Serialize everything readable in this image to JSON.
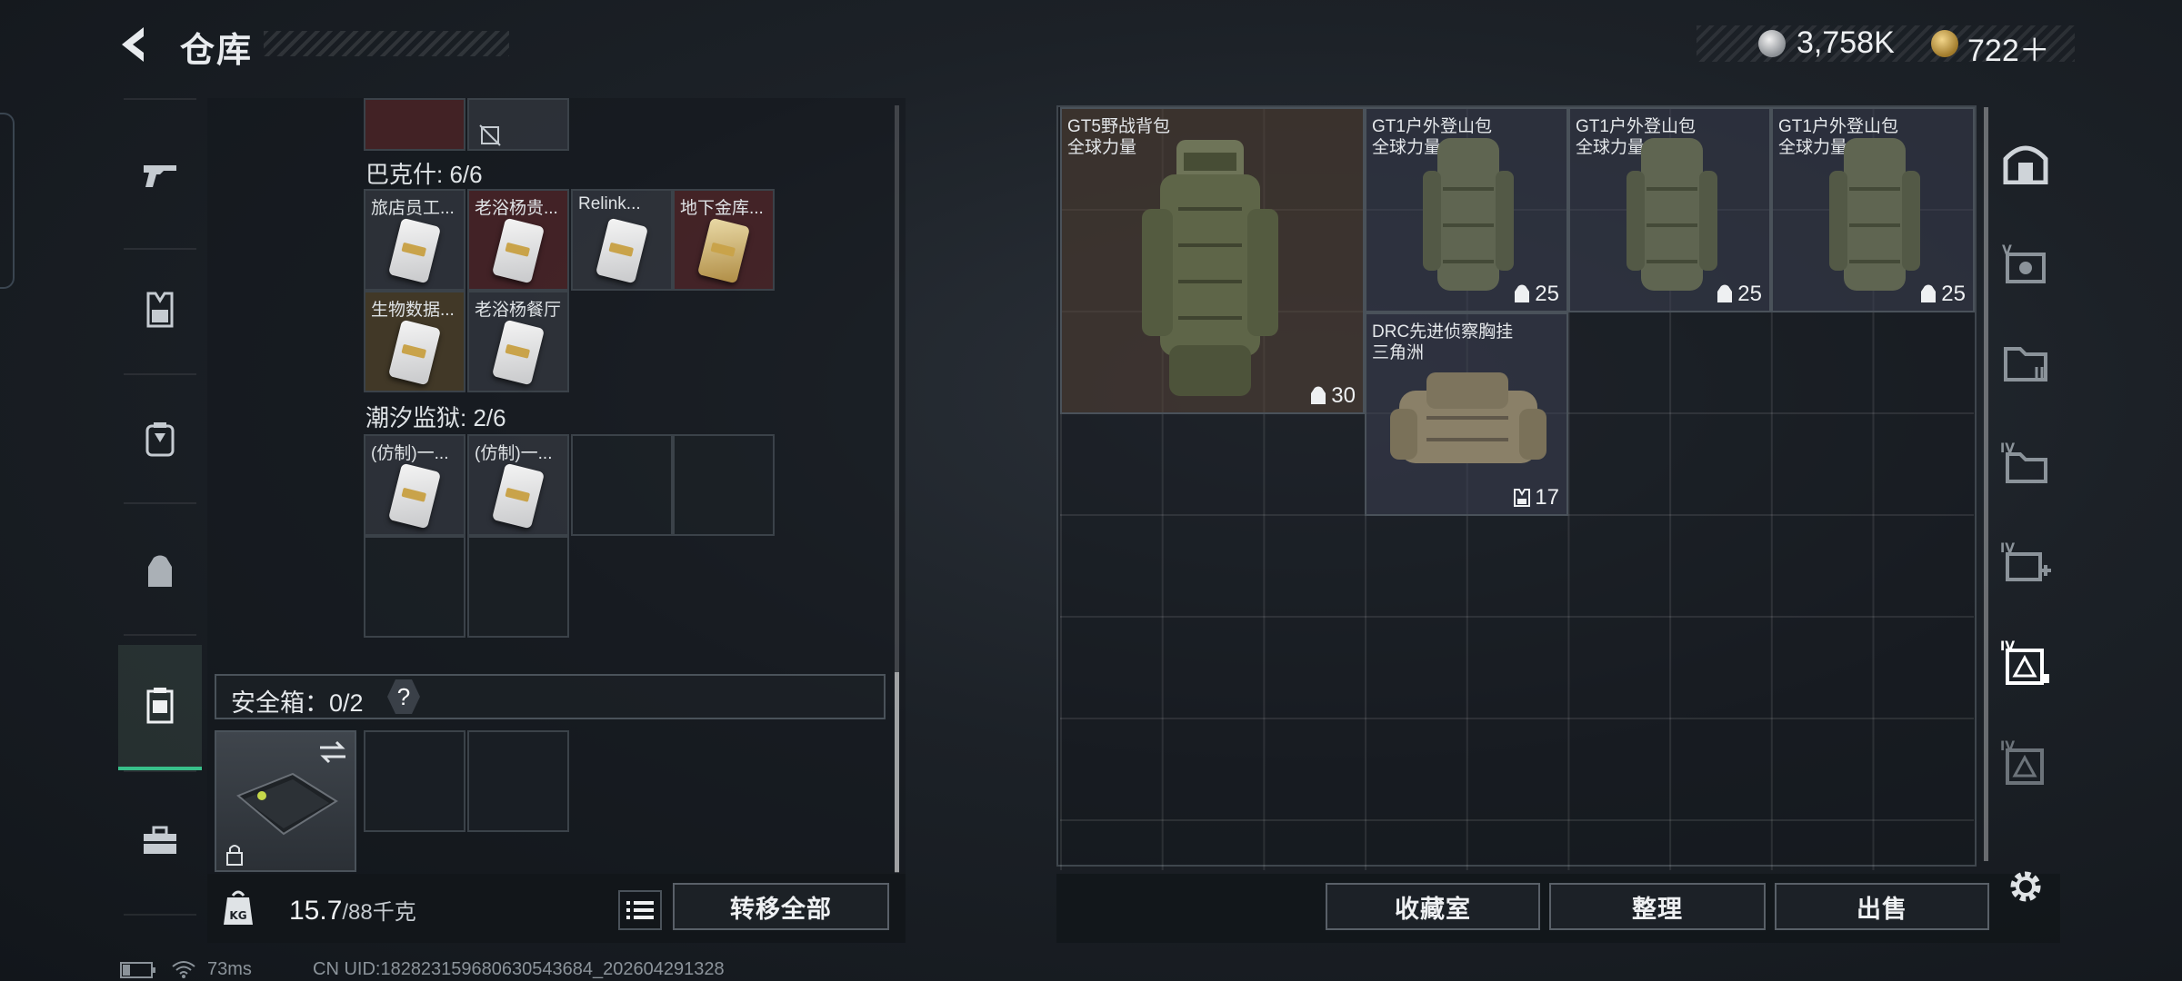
{
  "header": {
    "title": "仓库"
  },
  "currency": [
    {
      "icon": "silver-coin-icon",
      "value": "3,758K"
    },
    {
      "icon": "gold-coin-icon",
      "value": "722＋"
    }
  ],
  "left_tabs": [
    {
      "icon": "gun-icon"
    },
    {
      "icon": "armor-vest-icon"
    },
    {
      "icon": "chest-rig-icon"
    },
    {
      "icon": "backpack-icon"
    },
    {
      "icon": "safe-case-icon",
      "active": true
    },
    {
      "icon": "toolbox-icon"
    }
  ],
  "sections": {
    "s1_label": "巴克什: 6/6",
    "s1_items": [
      "旅店员工...",
      "老浴杨贵...",
      "Relink...",
      "地下金库...",
      "生物数据...",
      "老浴杨餐厅"
    ],
    "s2_label": "潮汐监狱: 2/6",
    "s2_items": [
      "(仿制)一...",
      "(仿制)一..."
    ]
  },
  "safe": {
    "label": "安全箱：0/2",
    "help": "?"
  },
  "weight": {
    "current": "15.7",
    "max": "/88千克"
  },
  "buttons": {
    "transfer_all": "转移全部",
    "collection": "收藏室",
    "organize": "整理",
    "sell": "出售"
  },
  "stash_items": [
    {
      "name": "GT5野战背包",
      "maker": "全球力量",
      "count": "30"
    },
    {
      "name": "GT1户外登山包",
      "maker": "全球力量",
      "count": "25"
    },
    {
      "name": "GT1户外登山包",
      "maker": "全球力量",
      "count": "25"
    },
    {
      "name": "GT1户外登山包",
      "maker": "全球力量",
      "count": "25"
    },
    {
      "name": "DRC先进侦察胸挂",
      "maker": "三角洲",
      "count": "17"
    }
  ],
  "right_tabs": [
    {
      "icon": "all-stash-icon"
    },
    {
      "icon": "stash-v-icon",
      "tier": "V"
    },
    {
      "icon": "stash-folder-icon"
    },
    {
      "icon": "stash-iv-folder-icon",
      "tier": "IV"
    },
    {
      "icon": "stash-iv-plus-icon",
      "tier": "IV"
    },
    {
      "icon": "stash-iv-frame-icon",
      "tier": "IV",
      "active": true
    },
    {
      "icon": "stash-iv-frame2-icon",
      "tier": "IV"
    }
  ],
  "status": {
    "ping": "73ms",
    "uid": "CN UID:182823159680630543684_202604291328"
  }
}
